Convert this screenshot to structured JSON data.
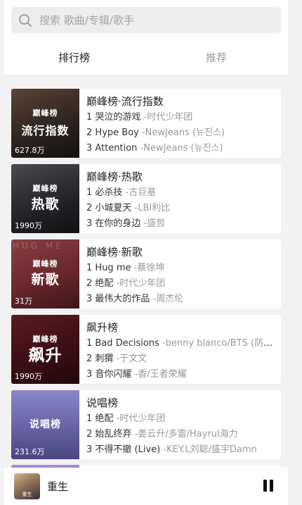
{
  "search": {
    "placeholder": "搜索 歌曲/专辑/歌手"
  },
  "tabs": [
    {
      "label": "排行榜",
      "active": true
    },
    {
      "label": "推荐",
      "active": false
    }
  ],
  "charts": [
    {
      "cover_brand": "巅峰榜",
      "cover_text": "流行指数",
      "listen_count": "627.8万",
      "title": "巅峰榜·流行指数",
      "songs": [
        {
          "rank": "1",
          "name": "哭泣的游戏",
          "artist": "-时代少年团"
        },
        {
          "rank": "2",
          "name": "Hype Boy",
          "artist": "-NewJeans (뉴진스)"
        },
        {
          "rank": "3",
          "name": "Attention",
          "artist": "-NewJeans (뉴진스)"
        }
      ]
    },
    {
      "cover_brand": "巅峰榜",
      "cover_text": "热歌",
      "listen_count": "1990万",
      "title": "巅峰榜·热歌",
      "songs": [
        {
          "rank": "1",
          "name": "必杀技",
          "artist": "-古巨基"
        },
        {
          "rank": "2",
          "name": "小城夏天",
          "artist": "-LBI利比"
        },
        {
          "rank": "3",
          "name": "在你的身边",
          "artist": "-盛哲"
        }
      ]
    },
    {
      "cover_brand": "巅峰榜",
      "cover_text": "新歌",
      "cover_bg_text": "HUG ME",
      "listen_count": "31万",
      "title": "巅峰榜·新歌",
      "songs": [
        {
          "rank": "1",
          "name": "Hug me",
          "artist": "-蔡徐坤"
        },
        {
          "rank": "2",
          "name": "绝配",
          "artist": "-时代少年团"
        },
        {
          "rank": "3",
          "name": "最伟大的作品",
          "artist": "-周杰伦"
        }
      ]
    },
    {
      "cover_brand": "巅峰榜",
      "cover_text": "飙升",
      "listen_count": "1990万",
      "title": "飙升榜",
      "songs": [
        {
          "rank": "1",
          "name": "Bad Decisions",
          "artist": "-benny blanco/BTS (防弹少年团)"
        },
        {
          "rank": "2",
          "name": "刺猬",
          "artist": "-于文文"
        },
        {
          "rank": "3",
          "name": "音你闪耀",
          "artist": "-香/王者荣耀"
        }
      ]
    },
    {
      "cover_brand": "",
      "cover_text": "说唱榜",
      "listen_count": "231.6万",
      "title": "说唱榜",
      "songs": [
        {
          "rank": "1",
          "name": "绝配",
          "artist": "-时代少年团"
        },
        {
          "rank": "2",
          "name": "始乱终弃",
          "artist": "-姜云升/多雷/Hayrul海力"
        },
        {
          "rank": "3",
          "name": "不得不撤 (Live)",
          "artist": "-KEY.L刘聪/盛宇Damn"
        }
      ]
    }
  ],
  "player": {
    "song_name": "重生",
    "album_tag": "重生"
  },
  "colors": {
    "background": "#f2f2f2",
    "card": "#ffffff",
    "artist_gray": "#999999"
  },
  "icons": {
    "search": "search-icon",
    "pause": "pause-icon"
  }
}
